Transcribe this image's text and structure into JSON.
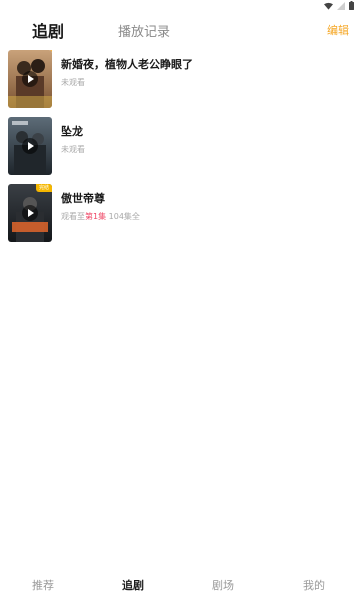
{
  "status_bar": {
    "icons": [
      "wifi-icon",
      "signal-icon",
      "battery-icon"
    ]
  },
  "top_tabs": {
    "active": "追剧",
    "history": "播放记录",
    "edit": "编辑"
  },
  "list": [
    {
      "title": "新婚夜，植物人老公睁眼了",
      "status": "未观看",
      "episode": "",
      "total": "",
      "badge": ""
    },
    {
      "title": "坠龙",
      "status": "未观看",
      "episode": "",
      "total": "",
      "badge": ""
    },
    {
      "title": "傲世帝尊",
      "status": "观看至",
      "episode": "第1集",
      "total": "104集全",
      "badge": "完结"
    }
  ],
  "bottom_nav": {
    "items": [
      "推荐",
      "追剧",
      "剧场",
      "我的"
    ],
    "active": "追剧"
  },
  "colors": {
    "accent": "#f5a623",
    "highlight": "#ef4766",
    "muted": "#a9a9a9"
  }
}
